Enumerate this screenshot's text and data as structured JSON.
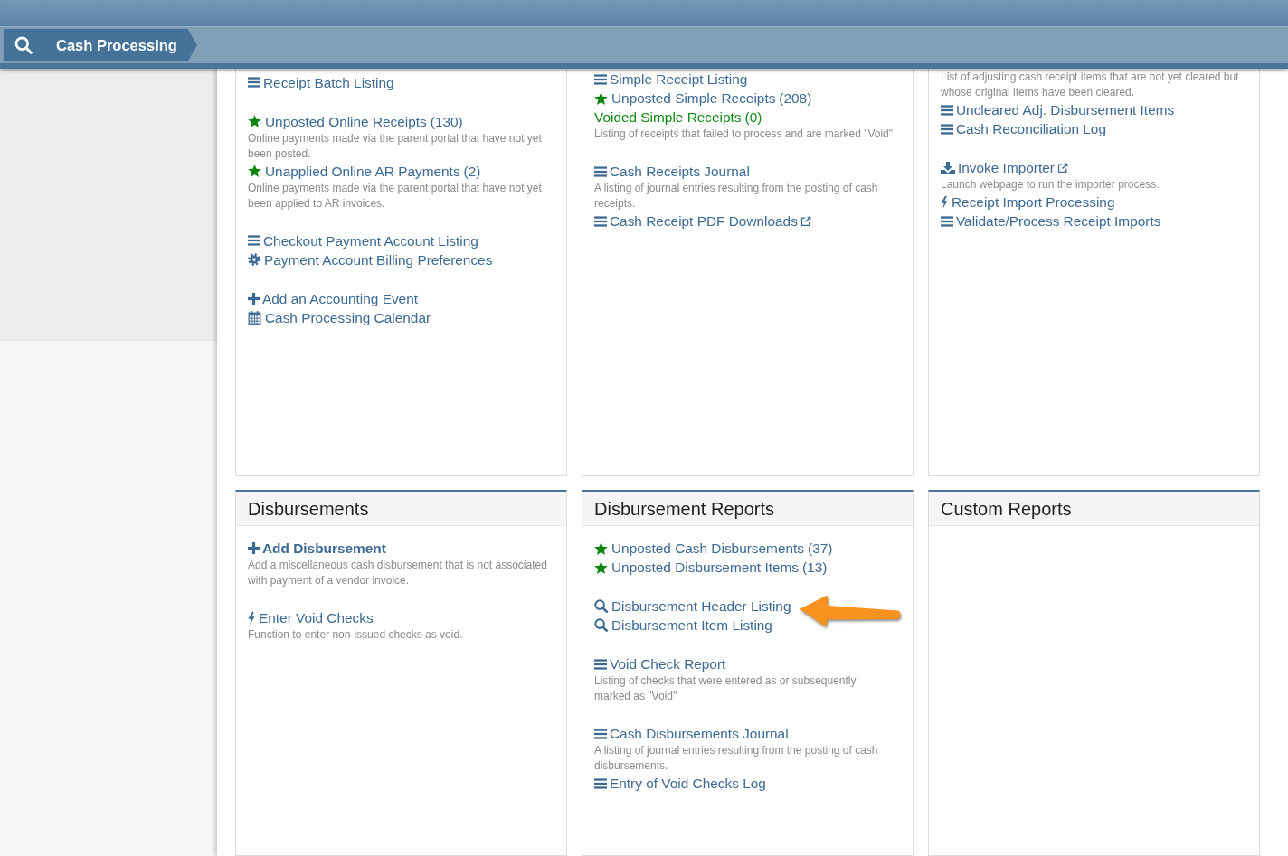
{
  "header": {
    "breadcrumb": "Cash Processing"
  },
  "rows": [
    {
      "panels": [
        {
          "groups": [
            [
              {
                "kind": "listing",
                "label": "Receipt Batch Listing"
              }
            ],
            [
              {
                "kind": "pending",
                "label": "Unposted Online Receipts",
                "count": "(130)",
                "description": "Online payments made via the parent portal that have not yet been posted."
              },
              {
                "kind": "pending",
                "label": "Unapplied Online AR Payments",
                "count": "(2)",
                "description": "Online payments made via the parent portal that have not yet been applied to AR invoices."
              }
            ],
            [
              {
                "kind": "listing",
                "label": "Checkout Payment Account Listing"
              },
              {
                "kind": "settings",
                "label": "Payment Account Billing Preferences"
              }
            ],
            [
              {
                "kind": "add",
                "label": "Add an Accounting Event"
              },
              {
                "kind": "calendar",
                "label": "Cash Processing Calendar"
              }
            ]
          ]
        },
        {
          "groups": [
            [
              {
                "kind": "listing",
                "label": "Simple Receipt Listing"
              },
              {
                "kind": "pending",
                "label": "Unposted Simple Receipts",
                "count": "(208)"
              },
              {
                "kind": "voided",
                "label": "Voided Simple Receipts",
                "count": "(0)",
                "description": "Listing of receipts that failed to process and are marked \"Void\""
              }
            ],
            [
              {
                "kind": "listing",
                "label": "Cash Receipts Journal",
                "description": "A listing of journal entries resulting from the posting of cash receipts."
              },
              {
                "kind": "listing",
                "label": "Cash Receipt PDF Downloads",
                "external": true
              }
            ]
          ]
        },
        {
          "groups": [
            [
              {
                "kind": "note",
                "description": "List of adjusting cash receipt items that are not yet cleared but whose original items have been cleared."
              },
              {
                "kind": "listing",
                "label": "Uncleared Adj. Disbursement Items"
              },
              {
                "kind": "listing",
                "label": "Cash Reconciliation Log"
              }
            ],
            [
              {
                "kind": "import",
                "label": "Invoke Importer",
                "external": true,
                "description": "Launch webpage to run the importer process."
              },
              {
                "kind": "process",
                "label": "Receipt Import Processing"
              },
              {
                "kind": "listing",
                "label": "Validate/Process Receipt Imports"
              }
            ]
          ]
        }
      ]
    },
    {
      "panels": [
        {
          "title": "Disbursements",
          "groups": [
            [
              {
                "kind": "add",
                "label": "Add Disbursement",
                "bold": true,
                "description": "Add a miscellaneous cash disbursement that is not associated with payment of a vendor invoice."
              }
            ],
            [
              {
                "kind": "process",
                "label": "Enter Void Checks",
                "description": "Function to enter non-issued checks as void."
              }
            ]
          ]
        },
        {
          "title": "Disbursement Reports",
          "groups": [
            [
              {
                "kind": "pending",
                "label": "Unposted Cash Disbursements",
                "count": "(37)"
              },
              {
                "kind": "pending",
                "label": "Unposted Disbursement Items",
                "count": "(13)"
              }
            ],
            [
              {
                "kind": "search",
                "label": "Disbursement Header Listing",
                "annotated": true
              },
              {
                "kind": "search",
                "label": "Disbursement Item Listing"
              }
            ],
            [
              {
                "kind": "listing",
                "label": "Void Check Report",
                "description": "Listing of checks that were entered as or subsequently marked as \"Void\""
              }
            ],
            [
              {
                "kind": "listing",
                "label": "Cash Disbursements Journal",
                "description": "A listing of journal entries resulting from the posting of cash disbursements."
              },
              {
                "kind": "listing",
                "label": "Entry of Void Checks Log"
              }
            ]
          ]
        },
        {
          "title": "Custom Reports"
        }
      ]
    }
  ]
}
